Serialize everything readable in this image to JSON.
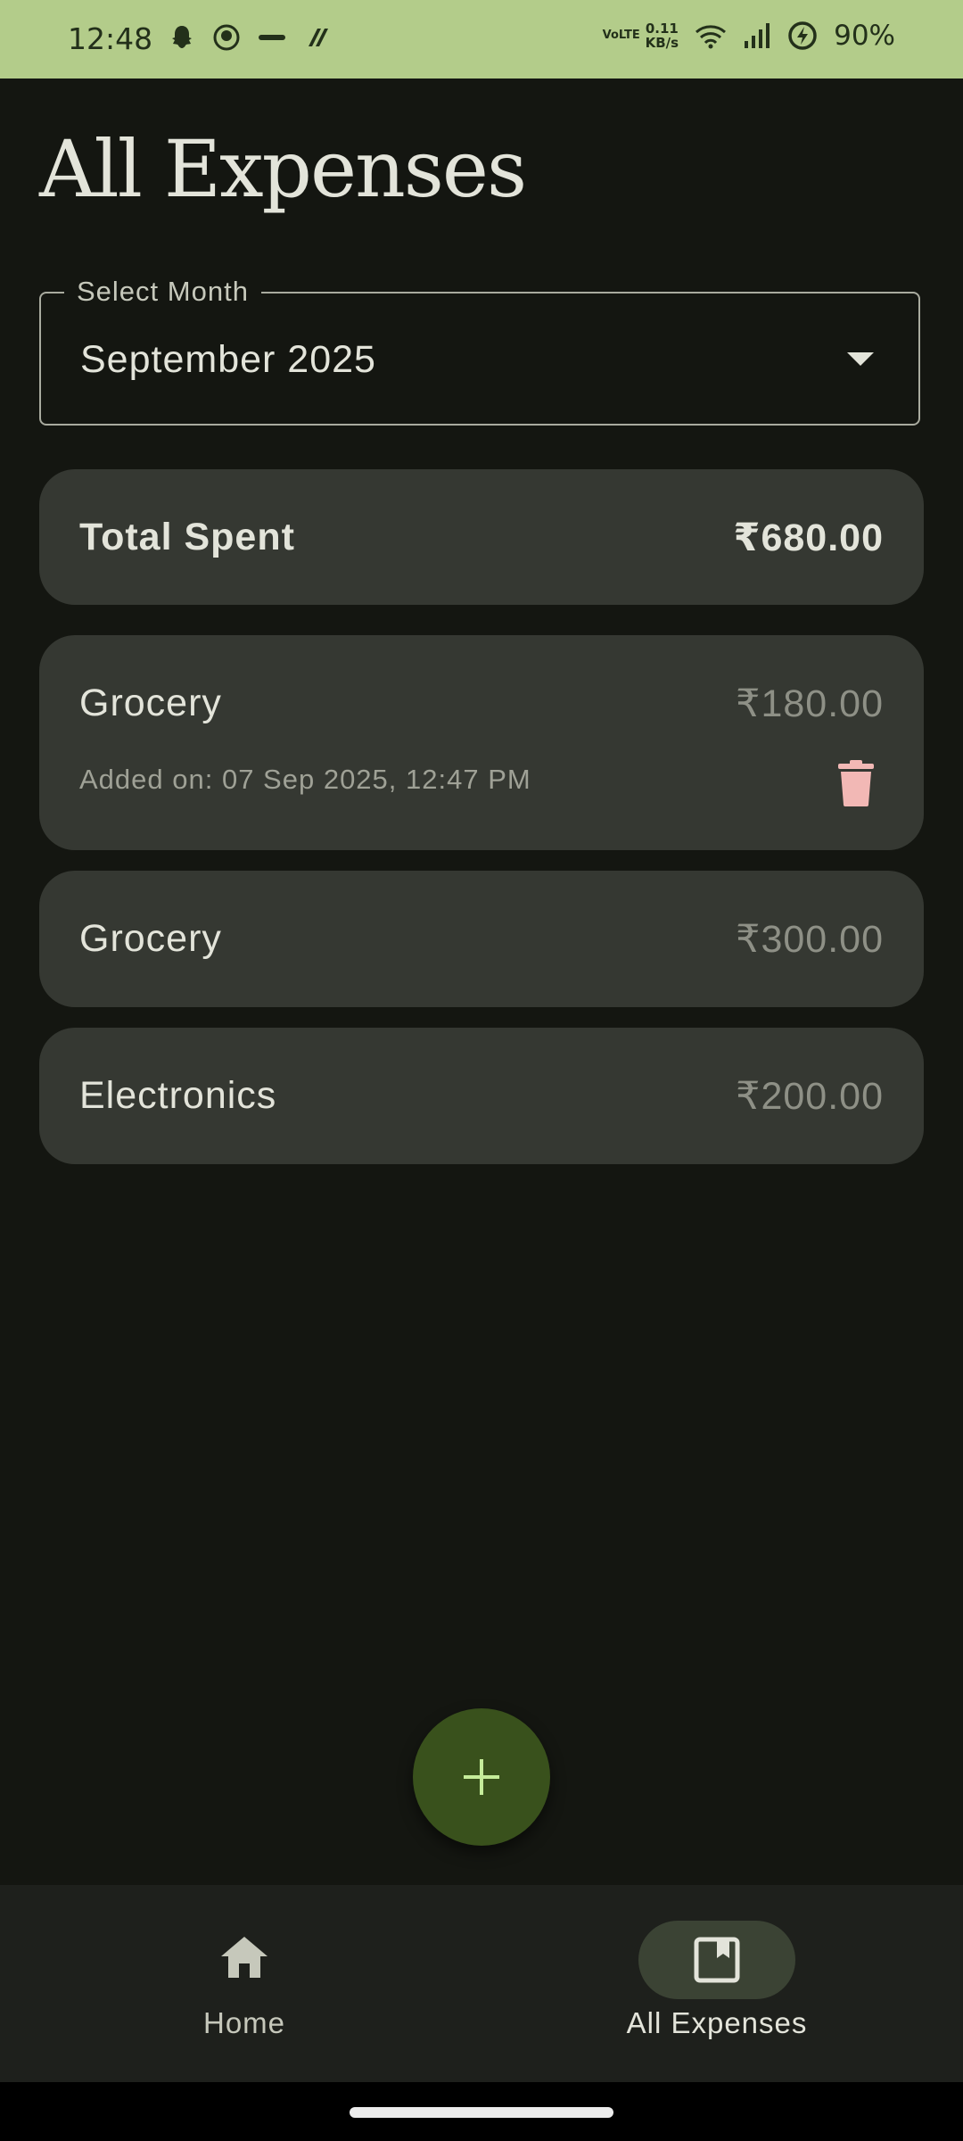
{
  "status_bar": {
    "time": "12:48",
    "network_speed_value": "0.11",
    "network_speed_unit": "KB/s",
    "volte": "VoLTE",
    "battery": "90%"
  },
  "page": {
    "title": "All Expenses"
  },
  "month_select": {
    "label": "Select Month",
    "value": "September 2025"
  },
  "total": {
    "label": "Total Spent",
    "amount": "₹680.00"
  },
  "expenses": [
    {
      "category": "Grocery",
      "amount": "₹180.00",
      "added_on": "Added on: 07 Sep 2025, 12:47 PM",
      "expanded": true
    },
    {
      "category": "Grocery",
      "amount": "₹300.00"
    },
    {
      "category": "Electronics",
      "amount": "₹200.00"
    }
  ],
  "fab": {
    "icon": "plus-icon"
  },
  "bottom_nav": {
    "items": [
      {
        "label": "Home",
        "icon": "home-icon",
        "selected": false
      },
      {
        "label": "All Expenses",
        "icon": "bookmark-icon",
        "selected": true
      }
    ]
  },
  "colors": {
    "background": "#141611",
    "status_bar": "#b3cc8a",
    "card": "#353832",
    "fab": "#39511c",
    "fab_icon": "#c5ec9a",
    "delete_icon": "#f2b8b5",
    "nav_pill": "#3b4334"
  }
}
